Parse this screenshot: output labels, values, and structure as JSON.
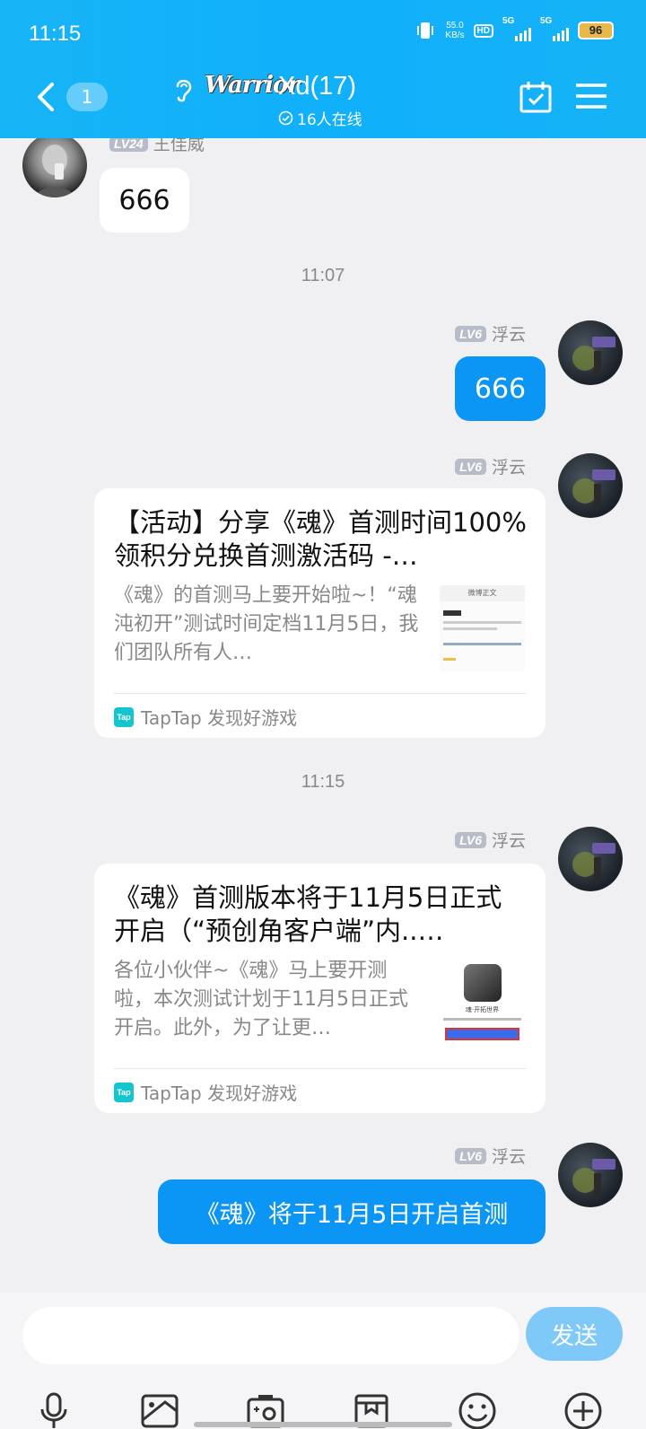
{
  "status_bar": {
    "time": "11:15",
    "net_speed_value": "55.0",
    "net_speed_unit": "KB/s",
    "hd_label": "HD",
    "sim1_label": "5G",
    "sim2_label": "5G",
    "battery": "96"
  },
  "header": {
    "unread_count": "1",
    "logo_text": "Warrior",
    "group_name": "Xd(17)",
    "online_text": "16人在线"
  },
  "messages": {
    "m1": {
      "level": "LV24",
      "sender": "王佳威",
      "text": "666"
    },
    "time1": "11:07",
    "m2": {
      "level": "LV6",
      "sender": "浮云",
      "text": "666"
    },
    "m3": {
      "level": "LV6",
      "sender": "浮云",
      "title": "【活动】分享《魂》首测时间100%领积分兑换首测激活码 -…",
      "desc": "《魂》的首测马上要开始啦~！“魂沌初开”测试时间定档11月5日，我们团队所有人…",
      "source": "TapTap 发现好游戏",
      "thumb_header": "微博正文"
    },
    "time2": "11:15",
    "m4": {
      "level": "LV6",
      "sender": "浮云",
      "title": "《魂》首测版本将于11月5日正式开启（“预创角客户端”内..…",
      "desc": "各位小伙伴~《魂》马上要开测啦，本次测试计划于11月5日正式开启。此外，为了让更…",
      "source": "TapTap 发现好游戏",
      "thumb_caption": "魂·开拓世界"
    },
    "m5": {
      "level": "LV6",
      "sender": "浮云",
      "text": "《魂》将于11月5日开启首测"
    }
  },
  "input": {
    "placeholder": "",
    "send_label": "发送"
  },
  "tap_icon_text": "Tap",
  "colors": {
    "header": "#10b0fb",
    "outgoing_bubble": "#0b95f5",
    "send_button": "#7fc9f8"
  },
  "icons": [
    "back-icon",
    "ear-icon",
    "calendar-check-icon",
    "menu-icon",
    "mic-icon",
    "image-icon",
    "camera-icon",
    "gift-icon",
    "emoji-icon",
    "plus-icon"
  ]
}
